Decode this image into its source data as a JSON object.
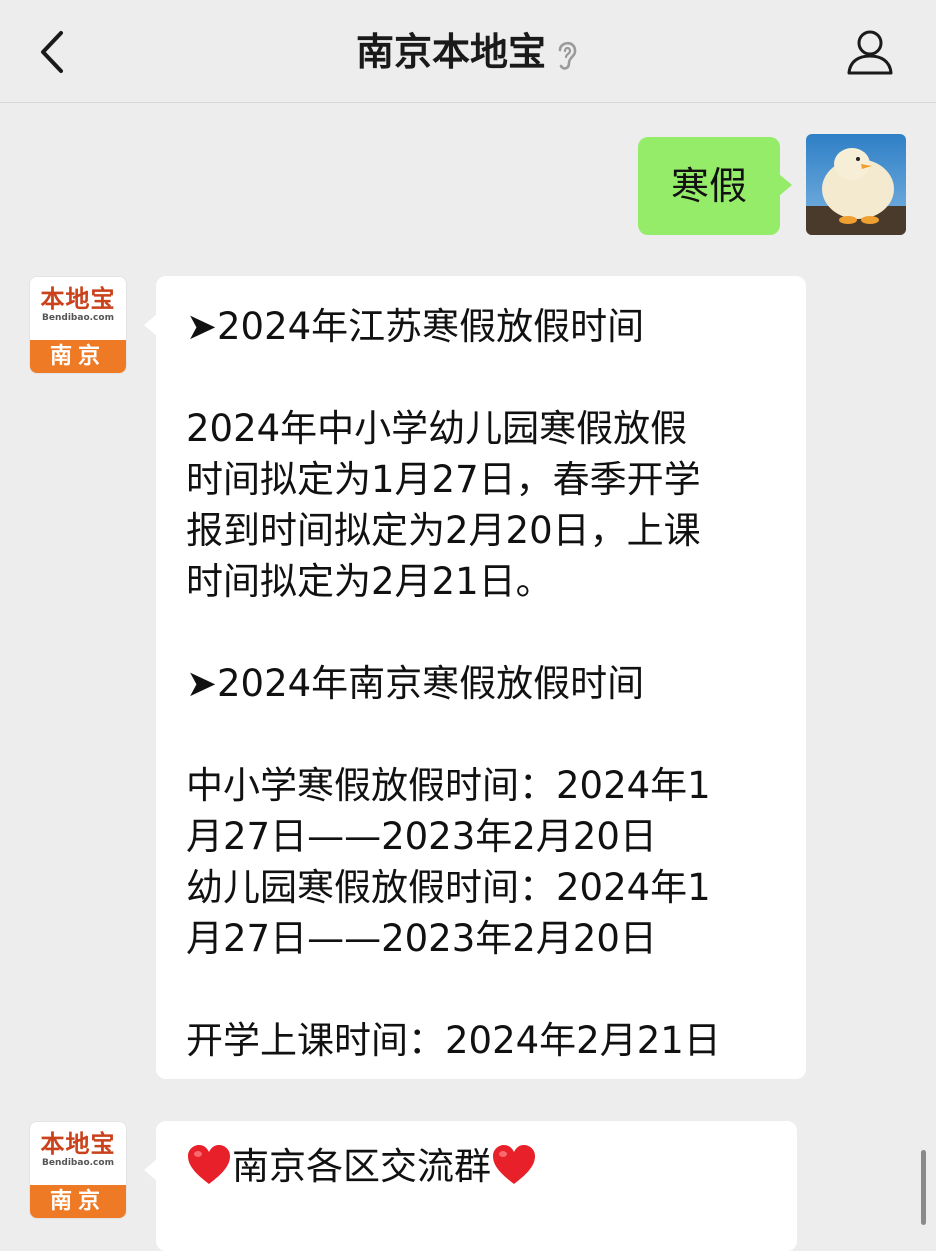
{
  "header": {
    "title": "南京本地宝"
  },
  "user_message": {
    "text": "寒假"
  },
  "bot": {
    "avatar_logo": "本地宝",
    "avatar_domain": "Bendibao.com",
    "avatar_city": "南京"
  },
  "bot_message_1": {
    "heading1": "➤2024年江苏寒假放假时间",
    "para1": [
      "2024年中小学幼儿园寒假放假",
      "时间拟定为1月27日，春季开学",
      "报到时间拟定为2月20日，上课",
      "时间拟定为2月21日。"
    ],
    "heading2": "➤2024年南京寒假放假时间",
    "para2": [
      "中小学寒假放假时间：2024年1",
      "月27日——2023年2月20日",
      "幼儿园寒假放假时间：2024年1",
      "月27日——2023年2月20日"
    ],
    "para3": "开学上课时间：2024年2月21日"
  },
  "bot_message_2": {
    "text": "南京各区交流群"
  },
  "colors": {
    "background": "#ededed",
    "user_bubble": "#95ec69",
    "bot_bubble": "#ffffff",
    "logo_orange": "#ef7a26",
    "logo_red": "#c9421c",
    "heart": "#e8202a"
  },
  "icons": {
    "back": "chevron-left-icon",
    "ear": "ear-icon",
    "profile": "person-icon",
    "heart": "red-heart-icon"
  }
}
